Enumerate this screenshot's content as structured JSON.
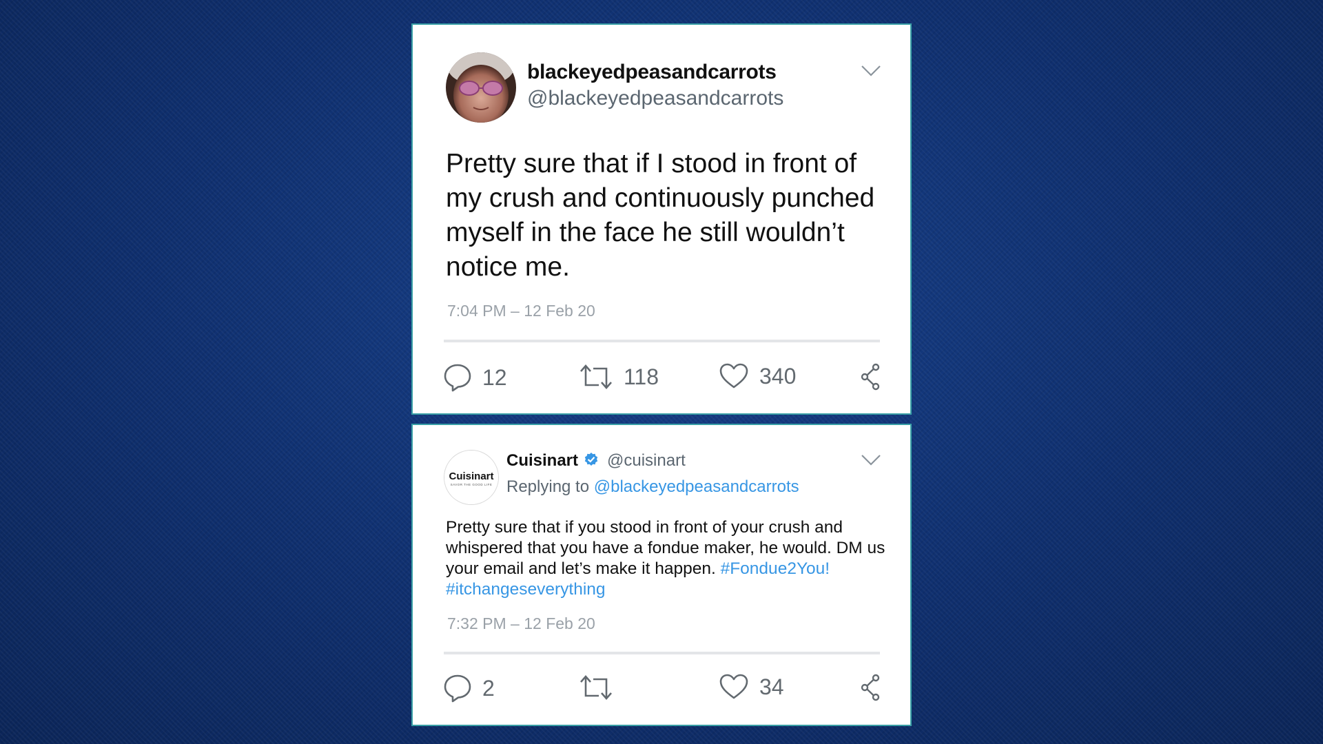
{
  "tweet1": {
    "display_name": "blackeyedpeasandcarrots",
    "handle": "@blackeyedpeasandcarrots",
    "text": "Pretty sure that if I stood in front of my crush and continuously punched myself in the face he still wouldn’t notice me.",
    "timestamp": "7:04 PM – 12 Feb 20",
    "replies": "12",
    "retweets": "118",
    "likes": "340"
  },
  "tweet2": {
    "display_name": "Cuisinart",
    "handle": "@cuisinart",
    "avatar_logo_text": "Cuisinart",
    "avatar_tagline": "SAVOR THE GOOD LIFE",
    "replying_to_label": "Replying to ",
    "replying_to_handle": "@blackeyedpeasandcarrots",
    "text": "Pretty sure that if you stood in front of your crush and whispered that you have a fondue maker, he would. DM us your email and let’s make it happen. ",
    "hashtag1": "#Fondue2You!",
    "hashtag2": "#itchangeseverything",
    "timestamp": "7:32 PM – 12 Feb 20",
    "replies": "2",
    "likes": "34"
  },
  "icons": [
    "chevron-down-icon",
    "reply-icon",
    "retweet-icon",
    "like-icon",
    "share-icon",
    "verified-badge-icon"
  ],
  "colors": {
    "background": "#0f2f6e",
    "card_border": "#39a0a6",
    "link": "#3796e4",
    "verified": "#3796e4",
    "secondary_text": "#5b6670"
  }
}
